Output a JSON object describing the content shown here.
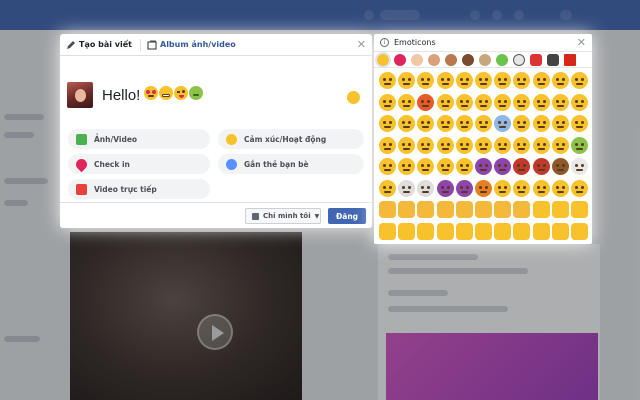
{
  "composer": {
    "tabs": [
      {
        "label": "Tạo bài viết",
        "icon": "pencil-icon"
      },
      {
        "label": "Album ảnh/video",
        "icon": "album-icon"
      }
    ],
    "post_text": "Hello!",
    "actions": [
      {
        "label": "Ảnh/Video",
        "icon": "photo-icon",
        "color": "#4caf50"
      },
      {
        "label": "Cảm xúc/Hoạt động",
        "icon": "feeling-icon",
        "color": "#f7c22c"
      },
      {
        "label": "Check in",
        "icon": "location-pin-icon",
        "color": "#e0245e"
      },
      {
        "label": "Gắn thẻ bạn bè",
        "icon": "tag-friends-icon",
        "color": "#5890ff"
      },
      {
        "label": "Video trực tiếp",
        "icon": "live-video-icon",
        "color": "#e9403a"
      }
    ],
    "privacy_label": "Chỉ mình tôi",
    "post_button": "Đăng"
  },
  "emoticons": {
    "title": "Emoticons"
  },
  "colors": {
    "accent": "#4267b2",
    "emoji_yellow": "#f7c22c",
    "facebook_blue": "#4267b2"
  }
}
